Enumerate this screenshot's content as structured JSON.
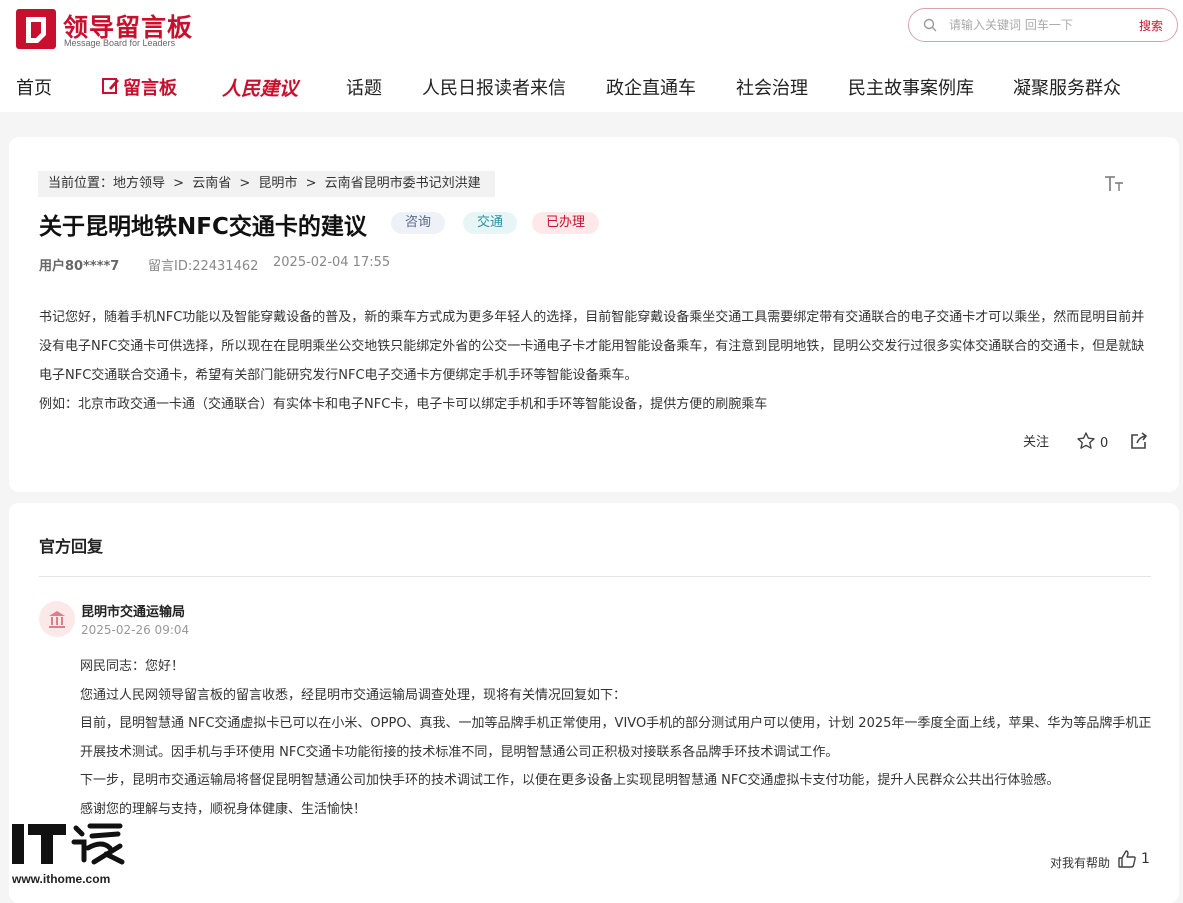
{
  "header": {
    "logo_title": "领导留言板",
    "logo_subtitle": "Message Board for Leaders",
    "search": {
      "placeholder": "请输入关键词 回车一下",
      "button_label": "搜索"
    },
    "nav": [
      "首页",
      "留言板",
      "人民建议",
      "话题",
      "人民日报读者来信",
      "政企直通车",
      "社会治理",
      "民主故事案例库",
      "凝聚服务群众"
    ],
    "active_nav": "留言板",
    "accent_color": "#c8102e"
  },
  "message": {
    "breadcrumb": [
      "当前位置：地方领导",
      ">",
      "云南省",
      ">",
      "昆明市",
      ">",
      "云南省昆明市委书记刘洪建"
    ],
    "title": "关于昆明地铁NFC交通卡的建议",
    "tags": [
      "咨询",
      "交通",
      "已办理"
    ],
    "user": "用户80****7",
    "message_id": "留言ID:22431462",
    "datetime": "2025-02-04 17:55",
    "paragraphs": [
      "书记您好，随着手机NFC功能以及智能穿戴设备的普及，新的乘车方式成为更多年轻人的选择，目前智能穿戴设备乘坐交通工具需要绑定带有交通联合的电子交通卡才可以乘坐，然而昆明目前并没有电子NFC交通卡可供选择，所以现在在昆明乘坐公交地铁只能绑定外省的公交一卡通电子卡才能用智能设备乘车，有注意到昆明地铁，昆明公交发行过很多实体交通联合的交通卡，但是就缺电子NFC交通联合交通卡，希望有关部门能研究发行NFC电子交通卡方便绑定手机手环等智能设备乘车。",
      "例如：北京市政交通一卡通（交通联合）有实体卡和电子NFC卡，电子卡可以绑定手机和手环等智能设备，提供方便的刷腕乘车"
    ],
    "follow_label": "关注",
    "favorite_count": "0"
  },
  "reply": {
    "section_title": "官方回复",
    "org_name": "昆明市交通运输局",
    "datetime": "2025-02-26 09:04",
    "paragraphs": [
      "网民同志：您好！",
      "您通过人民网领导留言板的留言收悉，经昆明市交通运输局调查处理，现将有关情况回复如下：",
      "目前，昆明智慧通 NFC交通虚拟卡已可以在小米、OPPO、真我、一加等品牌手机正常使用，VIVO手机的部分测试用户可以使用，计划 2025年一季度全面上线，苹果、华为等品牌手机正开展技术测试。因手机与手环使用 NFC交通卡功能衔接的技术标准不同，昆明智慧通公司正积极对接联系各品牌手环技术调试工作。",
      "下一步，昆明市交通运输局将督促昆明智慧通公司加快手环的技术调试工作，以便在更多设备上实现昆明智慧通 NFC交通虚拟卡支付功能，提升人民群众公共出行体验感。",
      "感谢您的理解与支持，顺祝身体健康、生活愉快！"
    ],
    "helpful_label": "对我有帮助",
    "helpful_count": "1"
  },
  "watermark": {
    "url": "www.ithome.com"
  }
}
